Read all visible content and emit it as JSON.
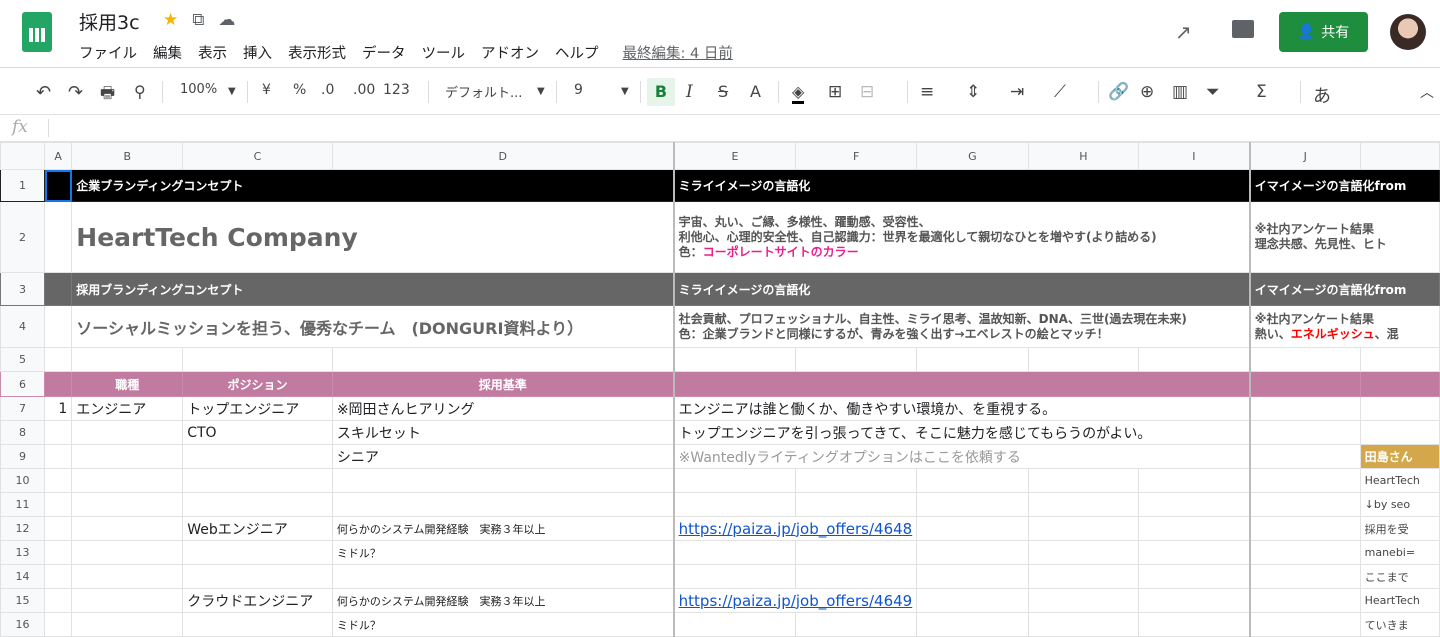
{
  "app": {
    "title": "採用3c",
    "menu": [
      "ファイル",
      "編集",
      "表示",
      "挿入",
      "表示形式",
      "データ",
      "ツール",
      "アドオン",
      "ヘルプ"
    ],
    "last_edit": "最終編集: 4 日前",
    "share_label": "共有"
  },
  "toolbar": {
    "zoom": "100%",
    "currency": "¥",
    "percent": "%",
    "dec_dec": ".0",
    "dec_inc": ".00",
    "format": "123",
    "font": "デフォルト...",
    "font_size": "9",
    "bold": "B",
    "italic": "I",
    "strike": "S",
    "text_color": "A",
    "ime": "あ"
  },
  "formula_bar": {
    "label": "fx",
    "value": ""
  },
  "columns": [
    "A",
    "B",
    "C",
    "D",
    "E",
    "F",
    "G",
    "H",
    "I",
    "J"
  ],
  "cells": {
    "r1": {
      "b": "企業ブランディングコンセプト",
      "e": "ミライイメージの言語化",
      "j": "イマイメージの言語化from"
    },
    "r2": {
      "b": "HeartTech Company",
      "e1": "宇宙、丸い、ご縁、多様性、躍動感、受容性、",
      "e2": "利他心、心理的安全性、自己認識力：世界を最適化して親切なひとを増やす(より詰める)",
      "e3_prefix": "色：",
      "e3_color": "コーポレートサイトのカラー",
      "j1": "※社内アンケート結果",
      "j2": "理念共感、先見性、ヒト"
    },
    "r3": {
      "b": "採用ブランディングコンセプト",
      "e": "ミライイメージの言語化",
      "j": "イマイメージの言語化from"
    },
    "r4": {
      "b": "ソーシャルミッションを担う、優秀なチーム　(DONGURI資料より）",
      "e1": "社会貢献、プロフェッショナル、自主性、ミライ思考、温故知新、DNA、三世(過去現在未来)",
      "e2": "色：企業ブランドと同様にするが、青みを強く出す→エベレストの絵とマッチ！",
      "j1": "※社内アンケート結果",
      "j2_prefix": "熱い、",
      "j2_color": "エネルギッシュ",
      "j2_suffix": "、混"
    },
    "r6": {
      "b": "職種",
      "c": "ポジション",
      "d": "採用基準"
    },
    "r7": {
      "a": "1",
      "b": "エンジニア",
      "c": "トップエンジニア",
      "d": "※岡田さんヒアリング",
      "e": "エンジニアは誰と働くか、働きやすい環境か、を重視する。"
    },
    "r8": {
      "c": "CTO",
      "d": "スキルセット",
      "e": "トップエンジニアを引っ張ってきて、そこに魅力を感じてもらうのがよい。"
    },
    "r9": {
      "d": "シニア",
      "e": "※Wantedlyライティングオプションはここを依頼する",
      "k": "田島さん"
    },
    "r10": {
      "k": "HeartTech"
    },
    "r11": {
      "k": "↓by seo"
    },
    "r12": {
      "c": "Webエンジニア",
      "d": "何らかのシステム開発経験　実務３年以上",
      "e": "https://paiza.jp/job_offers/4648",
      "k": "採用を受"
    },
    "r13": {
      "d": "ミドル？",
      "k": "manebi="
    },
    "r14": {
      "k": "ここまで"
    },
    "r15": {
      "c": "クラウドエンジニア",
      "d": "何らかのシステム開発経験　実務３年以上",
      "e": "https://paiza.jp/job_offers/4649",
      "k": "HeartTech"
    },
    "r16": {
      "d": "ミドル？",
      "k": "ていきま"
    }
  }
}
